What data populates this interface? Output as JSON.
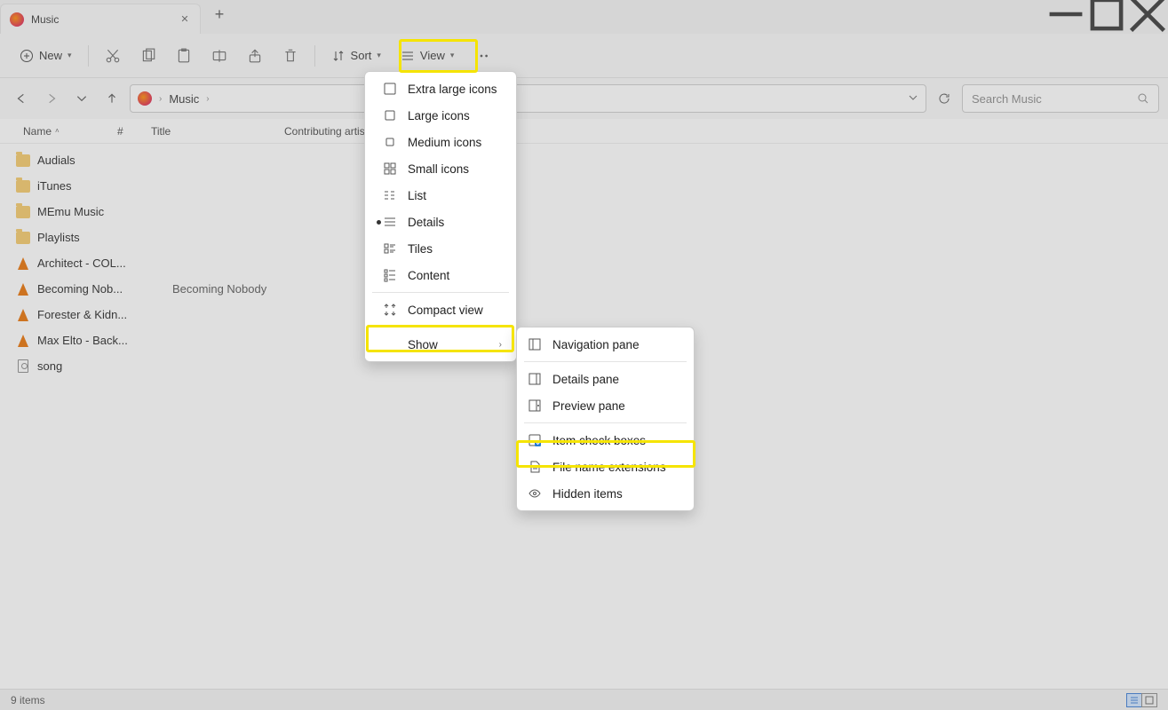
{
  "window": {
    "title": "Music"
  },
  "tabs": {
    "main": "Music"
  },
  "toolbar": {
    "new": "New",
    "sort": "Sort",
    "view": "View"
  },
  "breadcrumb": {
    "root": "Music"
  },
  "search": {
    "placeholder": "Search Music"
  },
  "columns": {
    "name": "Name",
    "hash": "#",
    "title": "Title",
    "contributing": "Contributing artis"
  },
  "files": [
    {
      "name": "Audials",
      "type": "folder"
    },
    {
      "name": "iTunes",
      "type": "folder"
    },
    {
      "name": "MEmu Music",
      "type": "folder"
    },
    {
      "name": "Playlists",
      "type": "folder"
    },
    {
      "name": "Architect - COL...",
      "type": "vlc"
    },
    {
      "name": "Becoming Nob...",
      "type": "vlc",
      "title": "Becoming Nobody"
    },
    {
      "name": "Forester & Kidn...",
      "type": "vlc"
    },
    {
      "name": "Max Elto - Back...",
      "type": "vlc"
    },
    {
      "name": "song",
      "type": "file"
    }
  ],
  "view_menu": {
    "extra_large": "Extra large icons",
    "large": "Large icons",
    "medium": "Medium icons",
    "small": "Small icons",
    "list": "List",
    "details": "Details",
    "tiles": "Tiles",
    "content": "Content",
    "compact": "Compact view",
    "show": "Show"
  },
  "show_menu": {
    "nav": "Navigation pane",
    "details": "Details pane",
    "preview": "Preview pane",
    "checks": "Item check boxes",
    "ext": "File name extensions",
    "hidden": "Hidden items"
  },
  "status": {
    "count": "9 items"
  }
}
